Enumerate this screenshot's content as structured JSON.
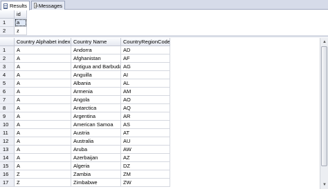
{
  "tabs": [
    {
      "label": "Results",
      "icon": "results-grid-icon"
    },
    {
      "label": "Messages",
      "icon": "messages-icon"
    }
  ],
  "grid1": {
    "header": "id",
    "rows": [
      {
        "n": "1",
        "id": "a"
      },
      {
        "n": "2",
        "id": "z"
      }
    ]
  },
  "grid2": {
    "headers": [
      "Country Alphabet index",
      "Country Name",
      "CountryRegionCode"
    ],
    "rows": [
      {
        "n": "1",
        "idx": "A",
        "name": "Andorra",
        "code": "AD"
      },
      {
        "n": "2",
        "idx": "A",
        "name": "Afghanistan",
        "code": "AF"
      },
      {
        "n": "3",
        "idx": "A",
        "name": "Antigua and Barbuda",
        "code": "AG"
      },
      {
        "n": "4",
        "idx": "A",
        "name": "Anguilla",
        "code": "AI"
      },
      {
        "n": "5",
        "idx": "A",
        "name": "Albania",
        "code": "AL"
      },
      {
        "n": "6",
        "idx": "A",
        "name": "Armenia",
        "code": "AM"
      },
      {
        "n": "7",
        "idx": "A",
        "name": "Angola",
        "code": "AO"
      },
      {
        "n": "8",
        "idx": "A",
        "name": "Antarctica",
        "code": "AQ"
      },
      {
        "n": "9",
        "idx": "A",
        "name": "Argentina",
        "code": "AR"
      },
      {
        "n": "10",
        "idx": "A",
        "name": "American Samoa",
        "code": "AS"
      },
      {
        "n": "11",
        "idx": "A",
        "name": "Austria",
        "code": "AT"
      },
      {
        "n": "12",
        "idx": "A",
        "name": "Australia",
        "code": "AU"
      },
      {
        "n": "13",
        "idx": "A",
        "name": "Aruba",
        "code": "AW"
      },
      {
        "n": "14",
        "idx": "A",
        "name": "Azerbaijan",
        "code": "AZ"
      },
      {
        "n": "15",
        "idx": "A",
        "name": "Algeria",
        "code": "DZ"
      },
      {
        "n": "16",
        "idx": "Z",
        "name": "Zambia",
        "code": "ZM"
      },
      {
        "n": "17",
        "idx": "Z",
        "name": "Zimbabwe",
        "code": "ZW"
      }
    ]
  }
}
